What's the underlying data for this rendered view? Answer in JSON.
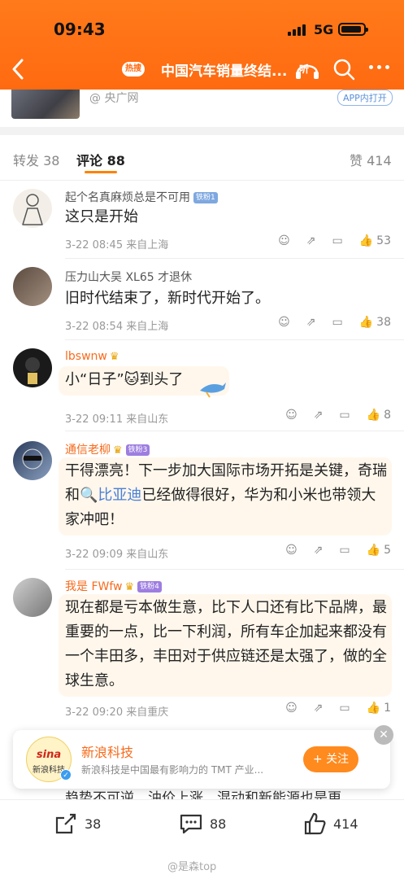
{
  "status_bar": {
    "time": "09:43",
    "network": "5G"
  },
  "nav": {
    "hot_tag": "热搜",
    "title": "中国汽车销量终结...",
    "listen_label": "听"
  },
  "source_card": {
    "source": "@ 央广网",
    "app_open": "APP内打开"
  },
  "tabs": [
    {
      "label": "转发",
      "count": "38"
    },
    {
      "label": "评论",
      "count": "88"
    },
    {
      "label": "赞",
      "count": "414"
    }
  ],
  "comments": [
    {
      "name": "起个名真麻烦总是不可用",
      "badge": "铁粉1",
      "text": [
        "这只是开始"
      ],
      "meta": "3-22 08:45  来自上海",
      "likes": "53"
    },
    {
      "name": "压力山大吴 XL65 才退休",
      "badge": "",
      "text": [
        "旧时代结束了，新时代开始了。"
      ],
      "meta": "3-22 08:54  来自上海",
      "likes": "38"
    },
    {
      "name": "lbswnw",
      "badge": "",
      "text": [
        "小“日子”🐱到头了"
      ],
      "meta": "3-22 09:11  来自山东",
      "likes": "8"
    },
    {
      "name": "通信老柳",
      "badge": "铁粉3",
      "text_pre": "干得漂亮！下一步加大国际市场开拓是关键，奇瑞和",
      "text_link": "比亚迪",
      "text_post": "已经做得很好，华为和小米也带领大家冲吧！",
      "meta": "3-22 09:09  来自山东",
      "likes": "5"
    },
    {
      "name": "我是 FWfw",
      "badge": "铁粉4",
      "text": [
        "现在都是亏本做生意，比下人口还有比下品牌，最重要的一点，比一下利润，所有车企加起来都没有一个丰田多，丰田对于供应链还是太强了，做的全球生意。"
      ],
      "meta": "3-22 09:20  来自重庆",
      "likes": "1"
    }
  ],
  "follow_card": {
    "logo_top": "sina",
    "logo_bottom": "新浪科技",
    "name": "新浪科技",
    "description": "新浪科技是中国最有影响力的 TMT 产业...",
    "follow_label": "+ 关注"
  },
  "peek_text": "趋势不可逆，油价上涨，混动和新能源也是更",
  "bottom_bar": {
    "repost": "38",
    "comment": "88",
    "like": "414"
  },
  "watermark": "@是森top",
  "colors": {
    "brand_orange": "#ff7a1a",
    "name_orange": "#f86b1c",
    "link_blue": "#4a7fd8"
  }
}
